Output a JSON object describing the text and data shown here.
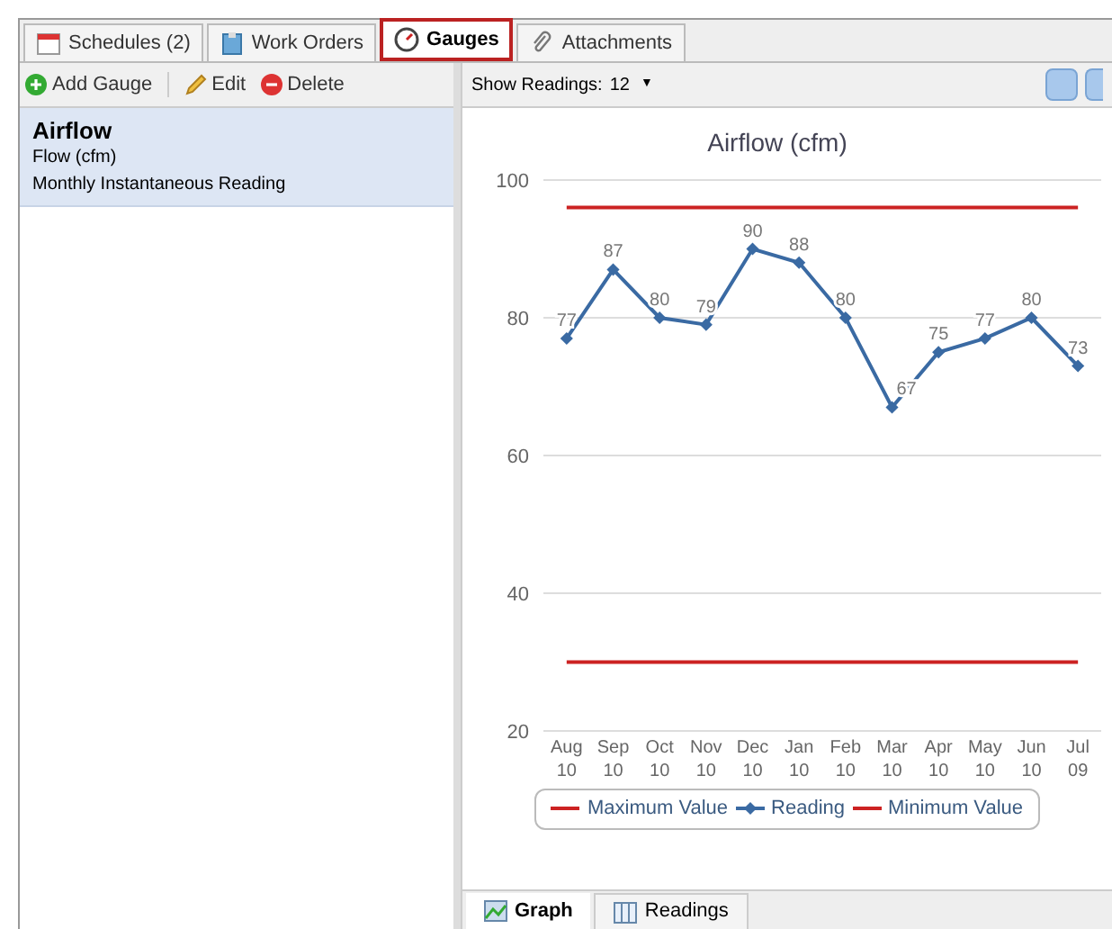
{
  "tabs": [
    {
      "label": "Schedules (2)",
      "selected": false
    },
    {
      "label": "Work Orders",
      "selected": false
    },
    {
      "label": "Gauges",
      "selected": true
    },
    {
      "label": "Attachments",
      "selected": false
    }
  ],
  "toolbar": {
    "buttons": [
      {
        "label": "Add Gauge",
        "kind": "add"
      },
      {
        "label": "Edit",
        "kind": "edit"
      },
      {
        "label": "Delete",
        "kind": "delete"
      }
    ]
  },
  "gauges": [
    {
      "name": "Airflow",
      "unit": "Flow (cfm)",
      "schedule": "Monthly Instantaneous Reading",
      "selected": true
    }
  ],
  "readings_bar": {
    "label": "Show Readings:",
    "value": "12",
    "caret": "▼"
  },
  "chart_data": {
    "type": "line",
    "title": "Airflow (cfm)",
    "categories": [
      "Aug 10",
      "Sep 10",
      "Oct 10",
      "Nov 10",
      "Dec 10",
      "Jan 10",
      "Feb 10",
      "Mar 10",
      "Apr 10",
      "May 10",
      "Jun 10",
      "Jul 09"
    ],
    "series": [
      {
        "name": "Maximum Value",
        "color": "#cc2222",
        "values": [
          96,
          96,
          96,
          96,
          96,
          96,
          96,
          96,
          96,
          96,
          96,
          96
        ]
      },
      {
        "name": "Reading",
        "color": "#3a6aa3",
        "marker": "diamond",
        "data_labels": true,
        "values": [
          77,
          87,
          80,
          79,
          90,
          88,
          80,
          67,
          75,
          77,
          80,
          73
        ]
      },
      {
        "name": "Minimum Value",
        "color": "#cc2222",
        "values": [
          30,
          30,
          30,
          30,
          30,
          30,
          30,
          30,
          30,
          30,
          30,
          30
        ]
      }
    ],
    "ylim": [
      20,
      100
    ],
    "yticks": [
      20,
      40,
      60,
      80,
      100
    ],
    "grid": true,
    "legend": true
  },
  "bottom_tabs": [
    {
      "label": "Graph",
      "selected": true
    },
    {
      "label": "Readings",
      "selected": false
    }
  ]
}
